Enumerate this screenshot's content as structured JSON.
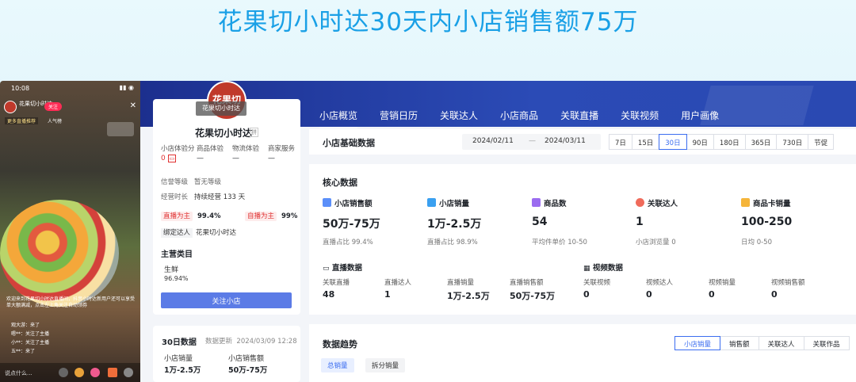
{
  "banner": {
    "title": "花果切小时达30天内小店销售额75万"
  },
  "phone": {
    "time": "10:08",
    "live_name": "花果切小时达",
    "follow": "关注",
    "sub_line": "更多直播推荐",
    "pop": "人气榜",
    "comments": [
      "欢迎来到花果切小时达直播间，抖音小时达新用户还可以享受单大额满减，点击左上角关注自动领券",
      "观大游：来了",
      "嗯**：关注了主播",
      "小**：关注了主播",
      "五**：来了"
    ],
    "say_placeholder": "说点什么..."
  },
  "nav": {
    "tabs": [
      "小店概览",
      "营销日历",
      "关联达人",
      "小店商品",
      "关联直播",
      "关联视频",
      "用户画像"
    ],
    "active_index": 0
  },
  "shop": {
    "logo_text": "花果切",
    "tooltip": "花果切小时达",
    "name": "花果切小时达",
    "name_tag": "拼",
    "metrics": [
      {
        "label": "小店体验分",
        "value": "0"
      },
      {
        "label": "商品体验",
        "value": "—"
      },
      {
        "label": "物流体验",
        "value": "—"
      },
      {
        "label": "商家服务",
        "value": "—"
      }
    ],
    "credit_label": "信誉等级",
    "credit_value": "暂无等级",
    "duration_label": "经营时长",
    "duration_value": "持续经营 133 天",
    "live_main_label": "直播为主",
    "live_main_value": "99.4%",
    "self_live_label": "自播为主",
    "self_live_value": "99%",
    "bound_label": "绑定达人",
    "bound_value": "花果切小时达",
    "category_title": "主营类目",
    "category_name": "生鲜",
    "category_pct": "96.94%",
    "follow_button": "关注小店"
  },
  "card30": {
    "title": "30日数据",
    "update_label": "数据更新",
    "update_time": "2024/03/09 12:28",
    "sales_volume_label": "小店销量",
    "sales_volume": "1万-2.5万",
    "sales_amount_label": "小店销售额",
    "sales_amount": "50万-75万"
  },
  "basic": {
    "title": "小店基础数据",
    "date_from": "2024/02/11",
    "date_sep": "—",
    "date_to": "2024/03/11",
    "ranges": [
      "7日",
      "15日",
      "30日",
      "90日",
      "180日",
      "365日",
      "730日",
      "节促"
    ],
    "active_range": 2
  },
  "core": {
    "title": "核心数据",
    "kpis": [
      {
        "label": "小店销售额",
        "value": "50万-75万",
        "sub": "直播占比 99.4%",
        "icon": "sales-icon",
        "color": "#5b8ff9"
      },
      {
        "label": "小店销量",
        "value": "1万-2.5万",
        "sub": "直播占比 98.9%",
        "icon": "volume-icon",
        "color": "#3aa0f0"
      },
      {
        "label": "商品数",
        "value": "54",
        "sub": "平均件单价 10-50",
        "icon": "goods-icon",
        "color": "#9b6cf0"
      },
      {
        "label": "关联达人",
        "value": "1",
        "sub": "小店浏览量 0",
        "icon": "user-icon",
        "color": "#f06b5b"
      },
      {
        "label": "商品卡销量",
        "value": "100-250",
        "sub": "日均 0-50",
        "icon": "card-icon",
        "color": "#f5b53a"
      }
    ],
    "live": {
      "title": "直播数据",
      "items": [
        {
          "label": "关联直播",
          "value": "48"
        },
        {
          "label": "直播达人",
          "value": "1"
        },
        {
          "label": "直播销量",
          "value": "1万-2.5万"
        },
        {
          "label": "直播销售额",
          "value": "50万-75万"
        }
      ]
    },
    "video": {
      "title": "视频数据",
      "items": [
        {
          "label": "关联视频",
          "value": "0"
        },
        {
          "label": "视频达人",
          "value": "0"
        },
        {
          "label": "视频销量",
          "value": "0"
        },
        {
          "label": "视频销售额",
          "value": "0"
        }
      ]
    }
  },
  "trend": {
    "title": "数据趋势",
    "tabs": [
      "小店销量",
      "销售额",
      "关联达人",
      "关联作品"
    ],
    "active_tab": 0,
    "pills": [
      "总销量",
      "拆分销量"
    ]
  }
}
